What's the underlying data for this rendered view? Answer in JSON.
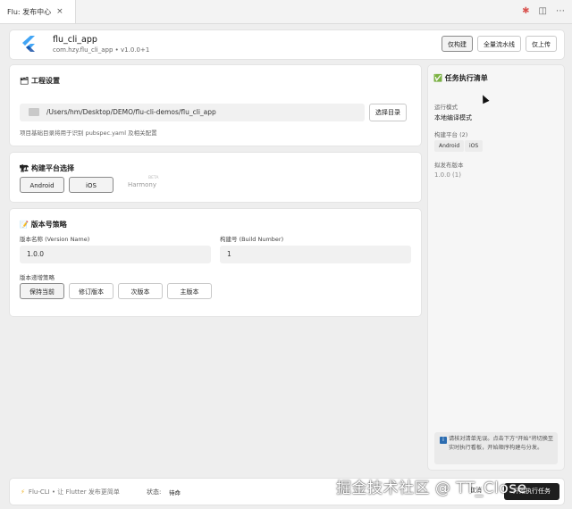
{
  "tab": {
    "label": "Flu: 发布中心",
    "close": "×"
  },
  "window_icons": [
    "bug-icon",
    "layout-icon",
    "more-icon"
  ],
  "header": {
    "app_name": "flu_cli_app",
    "app_sub": "com.hzy.flu_cli_app • v1.0.0+1",
    "buttons": [
      "仅构建",
      "全量流水线",
      "仅上传"
    ]
  },
  "project": {
    "title": "🗂 工程设置",
    "path": "/Users/hm/Desktop/DEMO/flu-cli-demos/flu_cli_app",
    "select_label": "选择目录",
    "hint": "项目基础目录将用于识别 pubspec.yaml 及相关配置"
  },
  "platforms": {
    "title": "🏗 构建平台选择",
    "items": [
      "Android",
      "iOS",
      "Harmony"
    ],
    "harmony_badge": "BETA"
  },
  "version": {
    "title": "📝 版本号策略",
    "name_label": "版本名称 (Version Name)",
    "name_value": "1.0.0",
    "build_label": "构建号 (Build Number)",
    "build_value": "1",
    "strategy_label": "版本递增策略",
    "strategies": [
      "保持当前",
      "修订版本",
      "次版本",
      "主版本"
    ]
  },
  "checklist": {
    "title": "✅ 任务执行清单",
    "mode_label": "运行模式",
    "mode_value": "本地编译模式",
    "platform_label": "构建平台 (2)",
    "platforms": [
      "Android",
      "iOS"
    ],
    "version_label": "拟发布版本",
    "version_value": "1.0.0 (1)",
    "notice": "请核对清单无误。点击下方\"开始\"将切换至实时执行看板，开始顺序构建与分发。"
  },
  "footer": {
    "left": "Flu-CLI • 让 Flutter 发布更简单",
    "status_label": "状态:",
    "status_value": "待命",
    "cancel_label": "取消",
    "start_label": "开始执行任务"
  },
  "watermark": "掘金技术社区 @ TT_Close",
  "colors": {
    "accent_dark": "#1f1f1f",
    "flutter_blue": "#42a5f5",
    "check_green": "#2e9d4a"
  }
}
